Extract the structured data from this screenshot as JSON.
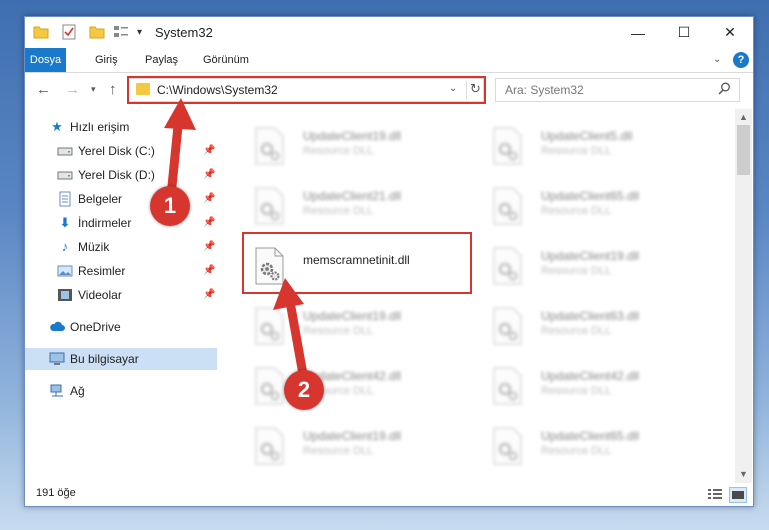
{
  "window": {
    "title": "System32"
  },
  "ribbon": {
    "tabs": [
      {
        "label": "Dosya"
      },
      {
        "label": "Giriş"
      },
      {
        "label": "Paylaş"
      },
      {
        "label": "Görünüm"
      }
    ],
    "help_label": "?"
  },
  "address": {
    "path": "C:\\Windows\\System32"
  },
  "search": {
    "placeholder": "Ara: System32"
  },
  "sidebar": {
    "items": [
      {
        "label": "Hızlı erişim",
        "icon": "star-icon"
      },
      {
        "label": "Yerel Disk (C:)",
        "icon": "drive-icon"
      },
      {
        "label": "Yerel Disk (D:)",
        "icon": "drive-icon"
      },
      {
        "label": "Belgeler",
        "icon": "documents-icon"
      },
      {
        "label": "İndirmeler",
        "icon": "download-icon"
      },
      {
        "label": "Müzik",
        "icon": "music-icon"
      },
      {
        "label": "Resimler",
        "icon": "pictures-icon"
      },
      {
        "label": "Videolar",
        "icon": "video-icon"
      },
      {
        "label": "OneDrive",
        "icon": "cloud-icon"
      },
      {
        "label": "Bu bilgisayar",
        "icon": "computer-icon"
      },
      {
        "label": "Ağ",
        "icon": "network-icon"
      }
    ]
  },
  "files": [
    {
      "name": "UpdateClient19.dll",
      "desc": "Resource DLL"
    },
    {
      "name": "UpdateClient5.dll",
      "desc": "Resource DLL"
    },
    {
      "name": "UpdateClient21.dll",
      "desc": "Resource DLL"
    },
    {
      "name": "UpdateClient65.dll",
      "desc": "Resource DLL"
    },
    {
      "name": "memscramnetinit.dll",
      "desc": ""
    },
    {
      "name": "UpdateClient19.dll",
      "desc": "Resource DLL"
    },
    {
      "name": "UpdateClient19.dll",
      "desc": "Resource DLL"
    },
    {
      "name": "UpdateClient63.dll",
      "desc": "Resource DLL"
    },
    {
      "name": "UpdateClient42.dll",
      "desc": "Resource DLL"
    },
    {
      "name": "UpdateClient42.dll",
      "desc": "Resource DLL"
    },
    {
      "name": "UpdateClient19.dll",
      "desc": "Resource DLL"
    },
    {
      "name": "UpdateClient65.dll",
      "desc": "Resource DLL"
    }
  ],
  "status": {
    "count": "191 öğe"
  },
  "annotations": {
    "step1": "1",
    "step2": "2"
  },
  "colors": {
    "accent": "#1979ca",
    "highlight": "#d7362f",
    "selection": "#cce0f5"
  }
}
